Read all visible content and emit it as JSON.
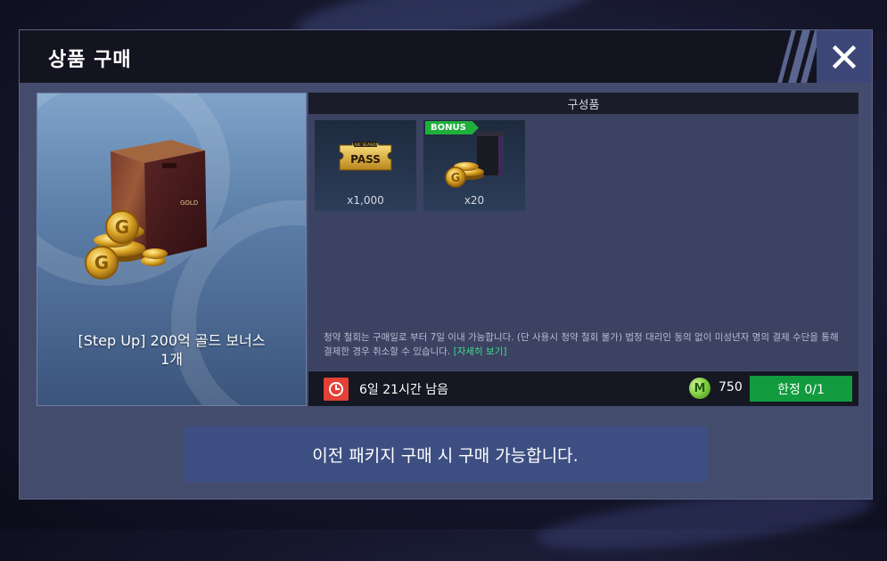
{
  "dialog": {
    "title": "상품 구매",
    "close_icon": "close-icon"
  },
  "product": {
    "name_line1": "[Step Up] 200억 골드 보너스",
    "name_line2": "1개",
    "icon": "gold-box-with-coins"
  },
  "contents": {
    "header": "구성품",
    "items": [
      {
        "icon": "live-season-pass-ticket",
        "ticket_small_text": "LIVE SEASON",
        "ticket_text": "PASS",
        "qty": "x1,000",
        "bonus": ""
      },
      {
        "icon": "gold-coins-with-box",
        "qty": "x20",
        "bonus": "BONUS"
      }
    ],
    "notice_text": "청약 철회는 구매일로 부터 7일 이내 가능합니다. (단 사용시 청약 철회 불가) 법정 대리인 동의 없이 미성년자 명의 결제 수단을 통해 결제한 경우 취소할 수 있습니다.",
    "notice_link": "[자세히 보기]"
  },
  "purchase": {
    "timer_icon": "clock-icon",
    "time_remaining": "6일 21시간 남음",
    "currency_icon": "mileage-coin-icon",
    "currency_symbol": "M",
    "price": "750",
    "limit_label": "한정 0/1"
  },
  "requirement_text": "이전 패키지 구매 시 구매 가능합니다.",
  "colors": {
    "dialog_bg": "#444c6e",
    "titlebar_bg": "#13141f",
    "accent_green": "#119b3e",
    "link_green": "#3fe08a",
    "timer_red": "#e44136",
    "banner_bg": "#3d4f82"
  }
}
